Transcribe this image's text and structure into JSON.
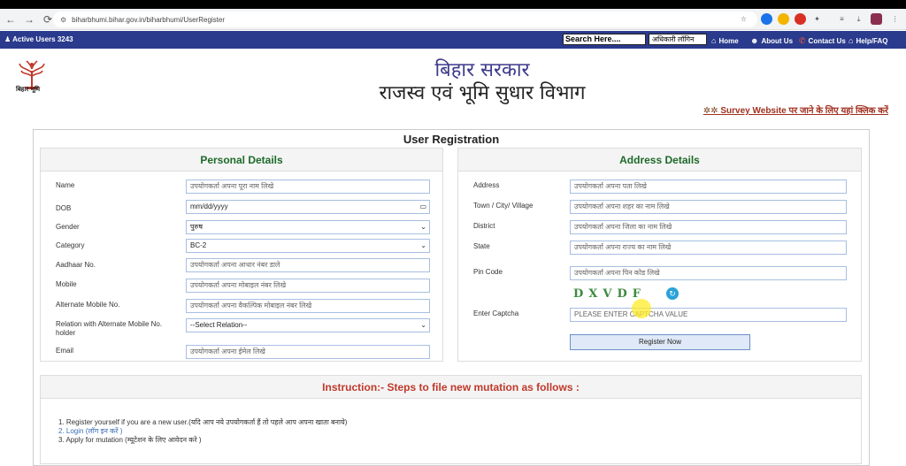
{
  "browser": {
    "url": "biharbhumi.bihar.gov.in/biharbhumi/UserRegister"
  },
  "topnav": {
    "active_users_label": "Active Users",
    "active_users_count": "3243",
    "search_placeholder": "Search Here....",
    "officer_login": "अधिकारी लॉगिन",
    "home": "Home",
    "about": "About Us",
    "contact": "Contact Us",
    "help": "Help/FAQ"
  },
  "header": {
    "emblem_caption": "बिहार भूमि",
    "title_line1": "बिहार सरकार",
    "title_line2": "राजस्व एवं भूमि सुधार विभाग",
    "survey_link": "Survey Website पर जाने के लिए यहां क्लिक करें"
  },
  "form": {
    "title": "User Registration",
    "personal": {
      "heading": "Personal Details",
      "name_label": "Name",
      "name_placeholder": "उपयोगकर्ता अपना पूरा नाम लिखे",
      "dob_label": "DOB",
      "dob_value": "mm/dd/yyyy",
      "gender_label": "Gender",
      "gender_value": "पुरुष",
      "category_label": "Category",
      "category_value": "BC-2",
      "aadhaar_label": "Aadhaar No.",
      "aadhaar_placeholder": "उपयोगकर्ता अपना आधार नंबर डाले",
      "mobile_label": "Mobile",
      "mobile_placeholder": "उपयोगकर्ता अपना मोबाइल नंबर लिखे",
      "alt_mobile_label": "Alternate Mobile No.",
      "alt_mobile_placeholder": "उपयोगकर्ता अपना वैकल्पिक मोबाइल नंबर लिखे",
      "relation_label": "Relation with Alternate Mobile No. holder",
      "relation_value": "--Select Relation--",
      "email_label": "Email",
      "email_placeholder": "उपयोगकर्ता अपना ईमेल लिखे"
    },
    "address": {
      "heading": "Address Details",
      "address_label": "Address",
      "address_placeholder": "उपयोगकर्ता अपना पता लिखे",
      "town_label": "Town / City/ Village",
      "town_placeholder": "उपयोगकर्ता अपना शहर का नाम लिखे",
      "district_label": "District",
      "district_placeholder": "उपयोगकर्ता अपना जिला का नाम लिखे",
      "state_label": "State",
      "state_placeholder": "उपयोगकर्ता अपना राज्य का नाम लिखे",
      "pin_label": "Pin Code",
      "pin_placeholder": "उपयोगकर्ता अपना पिन कोड लिखे",
      "captcha_text": "DXVDF",
      "captcha_label": "Enter Captcha",
      "captcha_placeholder": "PLEASE ENTER CAPTCHA VALUE",
      "register_button": "Register Now"
    }
  },
  "instructions": {
    "heading": "Instruction:- Steps to file new mutation as follows :",
    "step1": "1. Register yourself if you are a new user.(यदि आप नये उपयोगकर्ता हैं तो पहले आप अपना खाता बनाये)",
    "step2": "2. Login (लॉग इन करें )",
    "step3": "3. Apply for mutation (म्यूटेशन के लिए आवेदन करे )"
  }
}
